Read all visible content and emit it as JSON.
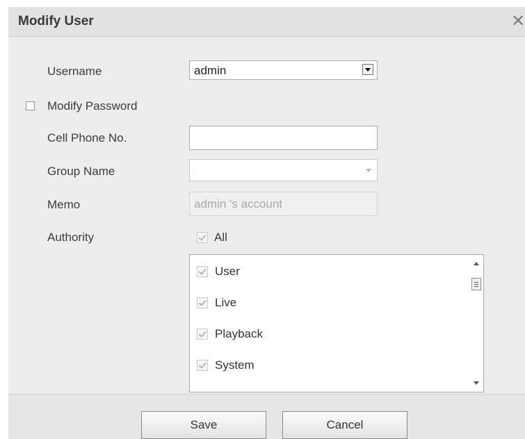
{
  "dialog": {
    "title": "Modify User",
    "close_glyph": "✕"
  },
  "form": {
    "username_label": "Username",
    "username_value": "admin",
    "modify_password_label": "Modify Password",
    "modify_password_checked": false,
    "cell_phone_label": "Cell Phone No.",
    "cell_phone_value": "",
    "group_name_label": "Group Name",
    "group_name_value": "",
    "memo_label": "Memo",
    "memo_value": "admin 's account",
    "authority_label": "Authority",
    "all_label": "All"
  },
  "permissions": [
    {
      "label": "User",
      "checked": true
    },
    {
      "label": "Live",
      "checked": true
    },
    {
      "label": "Playback",
      "checked": true
    },
    {
      "label": "System",
      "checked": true
    }
  ],
  "buttons": {
    "save": "Save",
    "cancel": "Cancel"
  },
  "icons": {
    "close": "close-icon",
    "dropdown": "chevron-down-icon",
    "checkbox": "checkbox-icon",
    "checkmark": "checkmark-icon"
  }
}
